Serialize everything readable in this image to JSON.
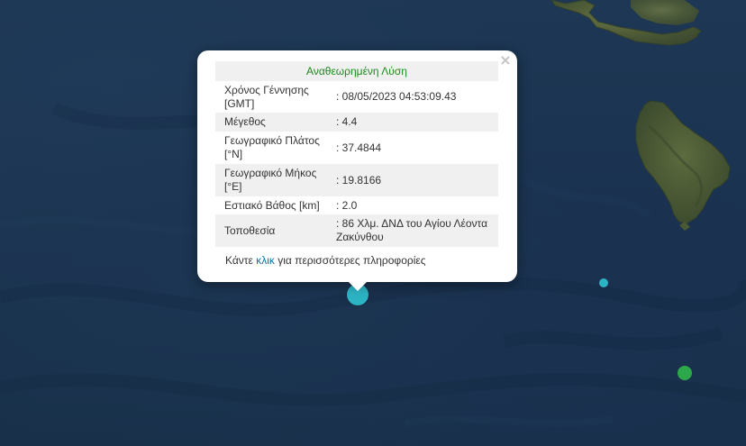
{
  "popup": {
    "close_symbol": "×",
    "heading": "Αναθεωρημένη Λύση",
    "rows": [
      {
        "label": "Χρόνος Γέννησης [GMT]",
        "value": ": 08/05/2023 04:53:09.43"
      },
      {
        "label": "Μέγεθος",
        "value": ": 4.4"
      },
      {
        "label": "Γεωγραφικό Πλάτος [°N]",
        "value": ": 37.4844"
      },
      {
        "label": "Γεωγραφικό Μήκος [°E]",
        "value": ": 19.8166"
      },
      {
        "label": "Εστιακό Βάθος [km]",
        "value": ": 2.0"
      },
      {
        "label": "Τοποθεσία",
        "value": ": 86 Χλμ. ΔΝΔ του Αγίου Λέοντα Ζακύνθου"
      }
    ],
    "footer_before": "Κάντε ",
    "footer_link": "κλικ",
    "footer_after": " για περισσότερες πληροφορίες"
  },
  "markers": [
    {
      "name": "selected-earthquake-marker",
      "color": "#2cb3c4"
    },
    {
      "name": "earthquake-marker-small",
      "color": "#2cb3c4"
    },
    {
      "name": "earthquake-marker-green",
      "color": "#2ca84a"
    }
  ],
  "colors": {
    "sea": "#1b3450",
    "land": "#4d5a36",
    "heading_green": "#1b8a1b",
    "link_blue": "#0078a8"
  }
}
